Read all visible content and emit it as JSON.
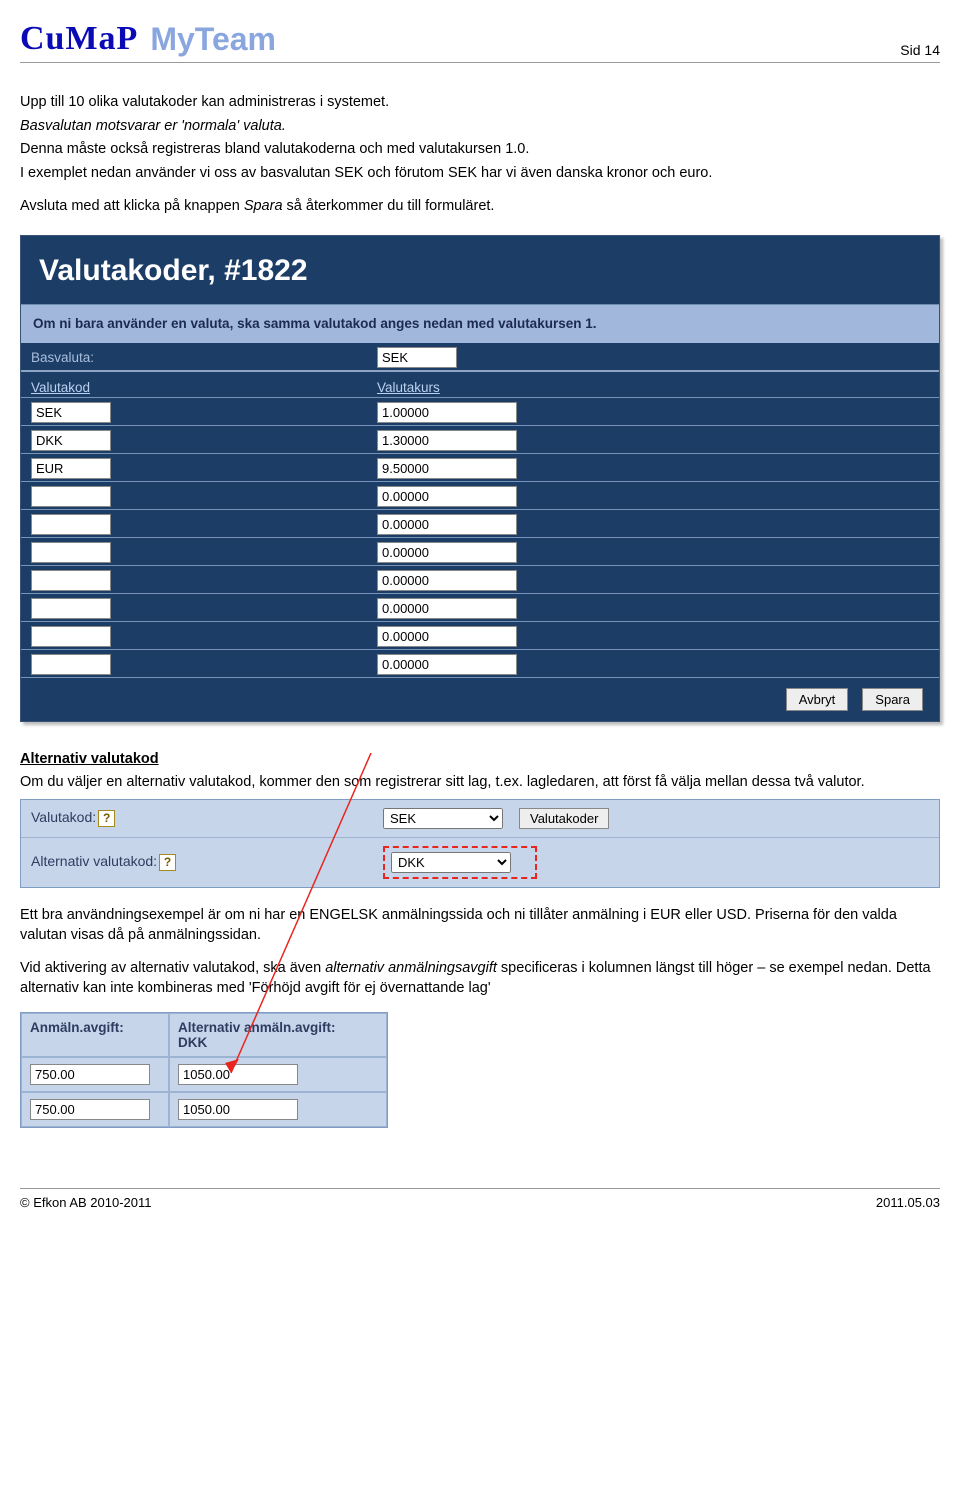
{
  "header": {
    "page_label": "Sid 14"
  },
  "logo": {
    "left": "CuMaP",
    "right": "MyTeam"
  },
  "intro": {
    "l1": "Upp till 10 olika valutakoder kan administreras i systemet.",
    "l2a": "Basvalutan motsvarar er 'normala' valuta.",
    "l3": "Denna måste också registreras bland valutakoderna och med valutakursen 1.0.",
    "l4": "I exemplet nedan använder vi oss av basvalutan SEK och förutom SEK har vi även danska kronor och euro.",
    "l5a": "Avsluta med att klicka på knappen ",
    "l5b": "Spara",
    "l5c": " så återkommer du till formuläret."
  },
  "panel": {
    "title": "Valutakoder, #1822",
    "info": "Om ni bara använder en valuta, ska samma valutakod anges nedan med valutakursen 1.",
    "base_label": "Basvaluta:",
    "base_value": "SEK",
    "col1": "Valutakod",
    "col2": "Valutakurs",
    "rows": [
      {
        "code": "SEK",
        "rate": "1.00000"
      },
      {
        "code": "DKK",
        "rate": "1.30000"
      },
      {
        "code": "EUR",
        "rate": "9.50000"
      },
      {
        "code": "",
        "rate": "0.00000"
      },
      {
        "code": "",
        "rate": "0.00000"
      },
      {
        "code": "",
        "rate": "0.00000"
      },
      {
        "code": "",
        "rate": "0.00000"
      },
      {
        "code": "",
        "rate": "0.00000"
      },
      {
        "code": "",
        "rate": "0.00000"
      },
      {
        "code": "",
        "rate": "0.00000"
      }
    ],
    "cancel": "Avbryt",
    "save": "Spara"
  },
  "alt": {
    "head": "Alternativ valutakod",
    "body": "Om du väljer en alternativ valutakod, kommer den som registrerar sitt lag, t.ex. lagledaren, att först få välja mellan dessa två valutor.",
    "label1": "Valutakod:",
    "sel1": "SEK",
    "btn": "Valutakoder",
    "label2": "Alternativ valutakod:",
    "sel2": "DKK"
  },
  "after": {
    "p1": "Ett bra användningsexempel är om ni har en ENGELSK anmälningssida och ni tillåter anmälning i EUR eller USD. Priserna för den valda valutan visas då på anmälningssidan.",
    "p2a": "Vid aktivering av alternativ valutakod, ska även ",
    "p2b": "alternativ anmälningsavgift",
    "p2c": " specificeras i kolumnen längst till höger – se exempel nedan. Detta alternativ kan inte kombineras med 'Förhöjd avgift för ej övernattande lag'"
  },
  "table2": {
    "h1": "Anmäln.avgift:",
    "h2a": "Alternativ anmäln.avgift:",
    "h2b": "DKK",
    "rows": [
      {
        "a": "750.00",
        "b": "1050.00"
      },
      {
        "a": "750.00",
        "b": "1050.00"
      }
    ]
  },
  "footer": {
    "left": "© Efkon AB 2010-2011",
    "right": "2011.05.03"
  }
}
